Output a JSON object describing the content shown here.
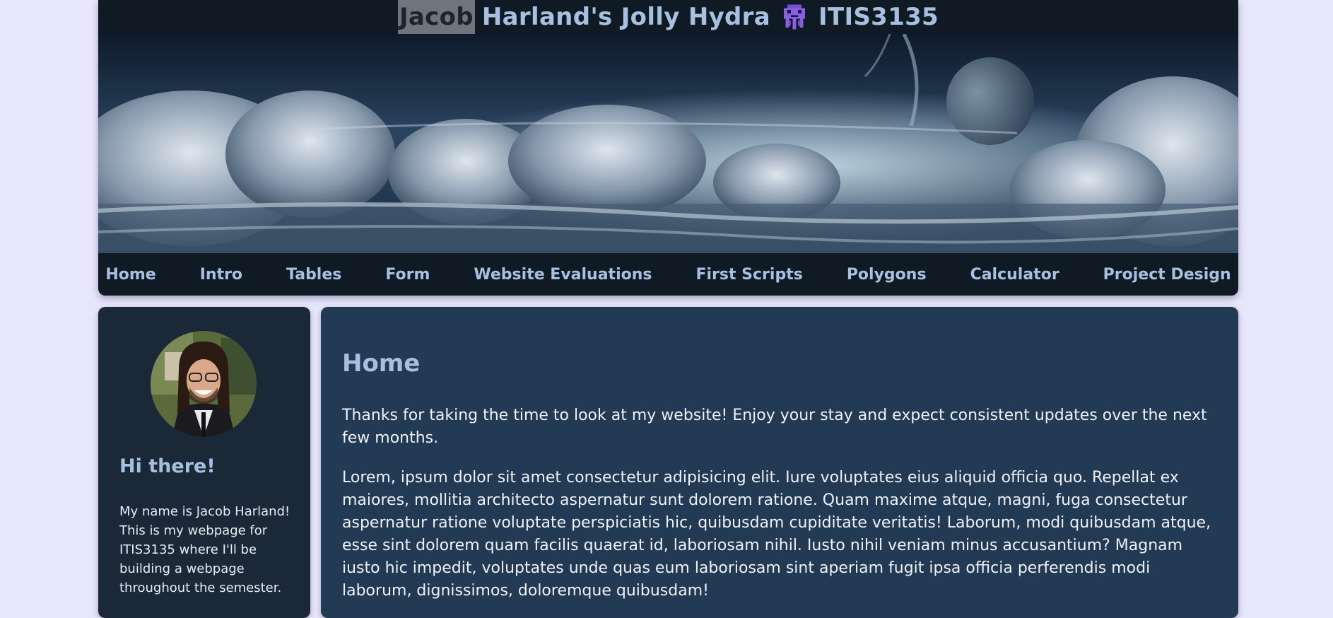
{
  "header": {
    "title_highlight": "Jacob",
    "title_rest": "Harland's Jolly Hydra",
    "title_icon": "alien-monster-icon",
    "title_course": "ITIS3135",
    "banner_image": "space-clouds-banner"
  },
  "nav": {
    "items": [
      {
        "label": "Home"
      },
      {
        "label": "Intro"
      },
      {
        "label": "Tables"
      },
      {
        "label": "Form"
      },
      {
        "label": "Website Evaluations"
      },
      {
        "label": "First Scripts"
      },
      {
        "label": "Polygons"
      },
      {
        "label": "Calculator"
      },
      {
        "label": "Project Design"
      }
    ]
  },
  "sidebar": {
    "avatar": "profile-photo",
    "heading": "Hi there!",
    "text": "My name is Jacob Harland! This is my webpage for ITIS3135 where I'll be building a webpage throughout the semester."
  },
  "main": {
    "heading": "Home",
    "paragraph1": "Thanks for taking the time to look at my website! Enjoy your stay and expect consistent updates over the next few months.",
    "paragraph2": "Lorem, ipsum dolor sit amet consectetur adipisicing elit. Iure voluptates eius aliquid officia quo. Repellat ex maiores, mollitia architecto aspernatur sunt dolorem ratione. Quam maxime atque, magni, fuga consectetur aspernatur ratione voluptate perspiciatis hic, quibusdam cupiditate veritatis! Laborum, modi quibusdam atque, esse sint dolorem quam facilis quaerat id, laboriosam nihil. Iusto nihil veniam minus accusantium? Magnam iusto hic impedit, voluptates unde quas eum laboriosam sint aperiam fugit ipsa officia perferendis modi laborum, dignissimos, doloremque quibusdam!"
  },
  "colors": {
    "page_bg": "#e8e6fb",
    "header_bg": "#101a25",
    "sidebar_bg": "#1a2838",
    "main_bg": "#233a54",
    "accent_text": "#a7c0df",
    "body_text": "#eef2f7"
  }
}
